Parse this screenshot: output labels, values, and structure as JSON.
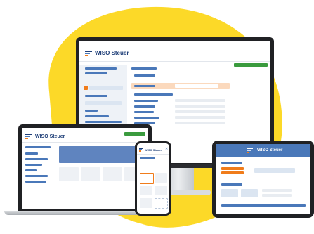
{
  "brand": {
    "name": "WISO Steuer",
    "accent_blue": "#4a78b9",
    "accent_orange": "#f07c1b",
    "accent_green": "#3a9b3e",
    "blob_color": "#fcd928"
  }
}
